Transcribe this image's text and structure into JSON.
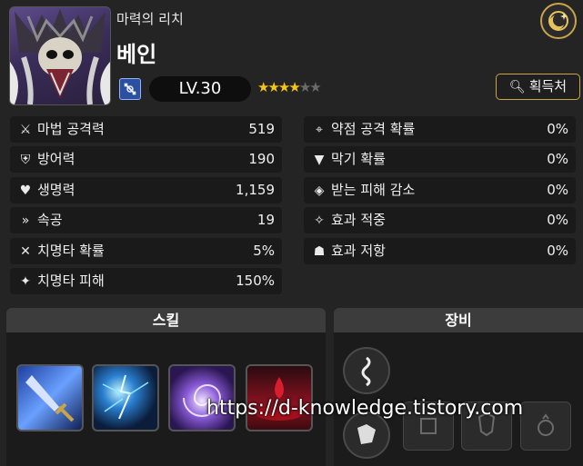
{
  "hero": {
    "subtitle": "마력의 리치",
    "name": "베인",
    "level": "LV.30",
    "stars_filled": 4,
    "stars_total": 6,
    "acquire_label": "획득처"
  },
  "stats_left": [
    {
      "icon": "magic-attack-icon",
      "label": "마법 공격력",
      "value": "519"
    },
    {
      "icon": "shield-icon",
      "label": "방어력",
      "value": "190"
    },
    {
      "icon": "heart-icon",
      "label": "생명력",
      "value": "1,159"
    },
    {
      "icon": "speed-icon",
      "label": "속공",
      "value": "19"
    },
    {
      "icon": "crit-rate-icon",
      "label": "치명타 확률",
      "value": "5%"
    },
    {
      "icon": "crit-damage-icon",
      "label": "치명타 피해",
      "value": "150%"
    }
  ],
  "stats_right": [
    {
      "icon": "crosshair-icon",
      "label": "약점 공격 확률",
      "value": "0%"
    },
    {
      "icon": "block-icon",
      "label": "막기 확률",
      "value": "0%"
    },
    {
      "icon": "damage-reduction-icon",
      "label": "받는 피해 감소",
      "value": "0%"
    },
    {
      "icon": "effect-hit-icon",
      "label": "효과 적중",
      "value": "0%"
    },
    {
      "icon": "effect-resist-icon",
      "label": "효과 저항",
      "value": "0%"
    }
  ],
  "panels": {
    "skill_title": "스킬",
    "equip_title": "장비"
  },
  "watermark": "https://d-knowledge.tistory.com"
}
